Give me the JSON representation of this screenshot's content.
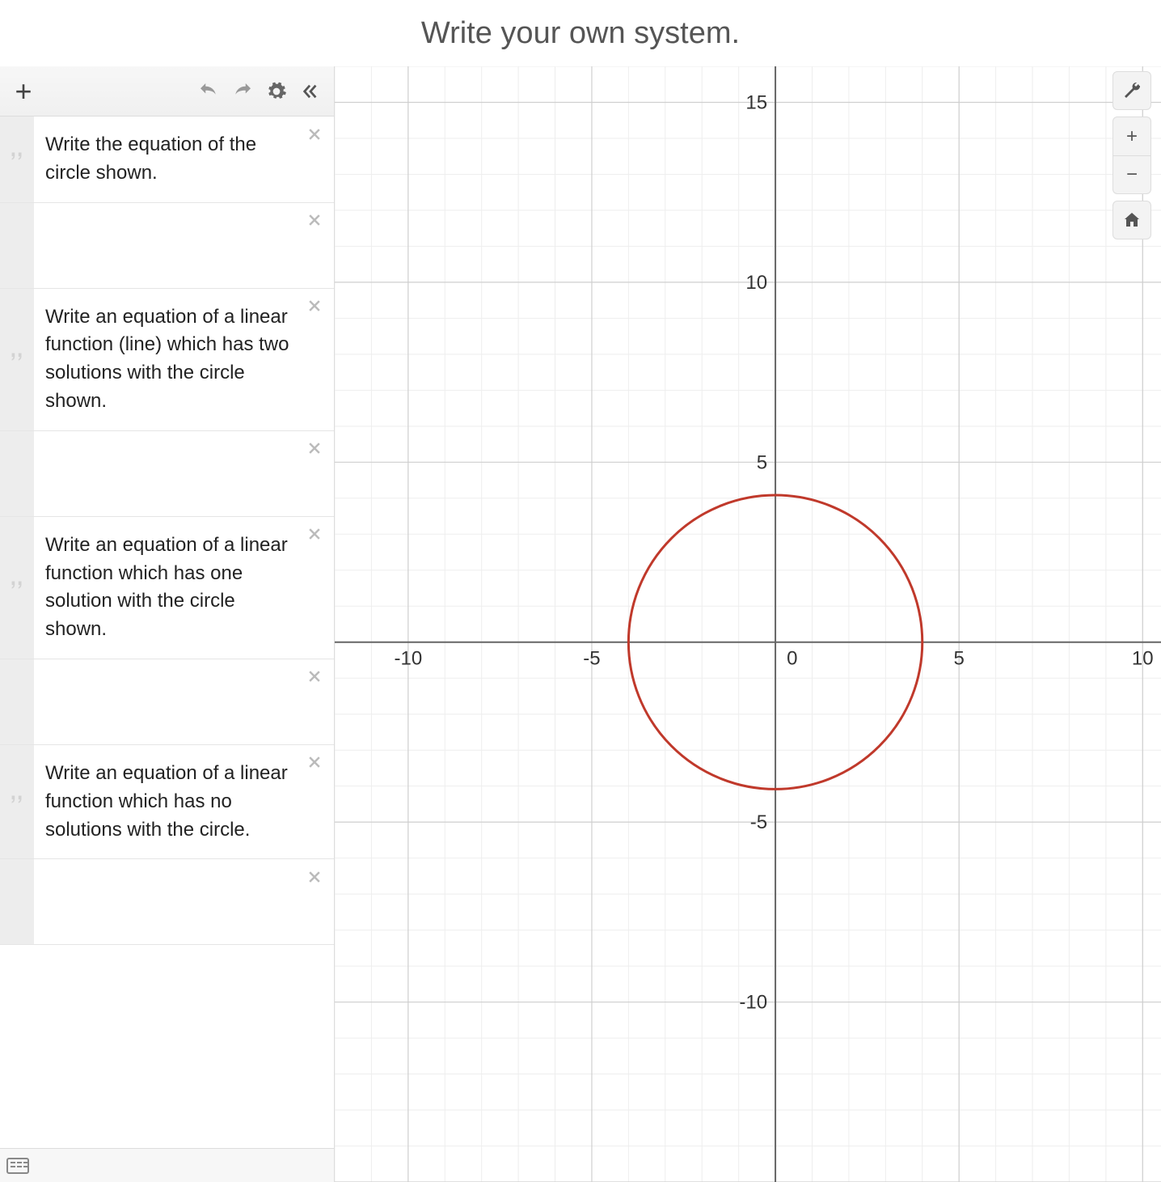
{
  "title": "Write your own system.",
  "toolbar": {
    "add_label": "+",
    "undo_label": "undo",
    "redo_label": "redo",
    "settings_label": "settings",
    "collapse_label": "collapse"
  },
  "expressions": [
    {
      "type": "note",
      "icon": "quote",
      "text": "Write the equation of the circle shown."
    },
    {
      "type": "blank",
      "icon": "",
      "text": ""
    },
    {
      "type": "note",
      "icon": "quote",
      "text": "Write an equation of a linear function (line) which has two solutions with the circle shown."
    },
    {
      "type": "blank",
      "icon": "",
      "text": ""
    },
    {
      "type": "note",
      "icon": "quote",
      "text": "Write an equation of a linear function which has one solution with the circle shown."
    },
    {
      "type": "blank",
      "icon": "",
      "text": ""
    },
    {
      "type": "note",
      "icon": "quote",
      "text": "Write an equation of a linear function which has no solutions with the circle."
    },
    {
      "type": "blank",
      "icon": "",
      "text": ""
    }
  ],
  "graph_controls": {
    "wrench": "graph settings",
    "zoom_in": "+",
    "zoom_out": "−",
    "home": "home"
  },
  "chart_data": {
    "type": "scatter",
    "title": "",
    "xlabel": "",
    "ylabel": "",
    "xlim": [
      -12,
      10.5
    ],
    "ylim": [
      -15,
      16
    ],
    "xticks": [
      -10,
      -5,
      0,
      5,
      10
    ],
    "yticks": [
      -10,
      -5,
      5,
      10,
      15
    ],
    "grid_major_step": 5,
    "grid_minor_step": 1,
    "shapes": [
      {
        "type": "circle",
        "cx": 0,
        "cy": 0,
        "r": 4,
        "stroke": "#c0392b",
        "fill": "none"
      }
    ],
    "series": []
  },
  "ui_colors": {
    "axis": "#666666",
    "grid_major": "#cfcfcf",
    "grid_minor": "#eeeeee",
    "circle": "#c0392b"
  }
}
